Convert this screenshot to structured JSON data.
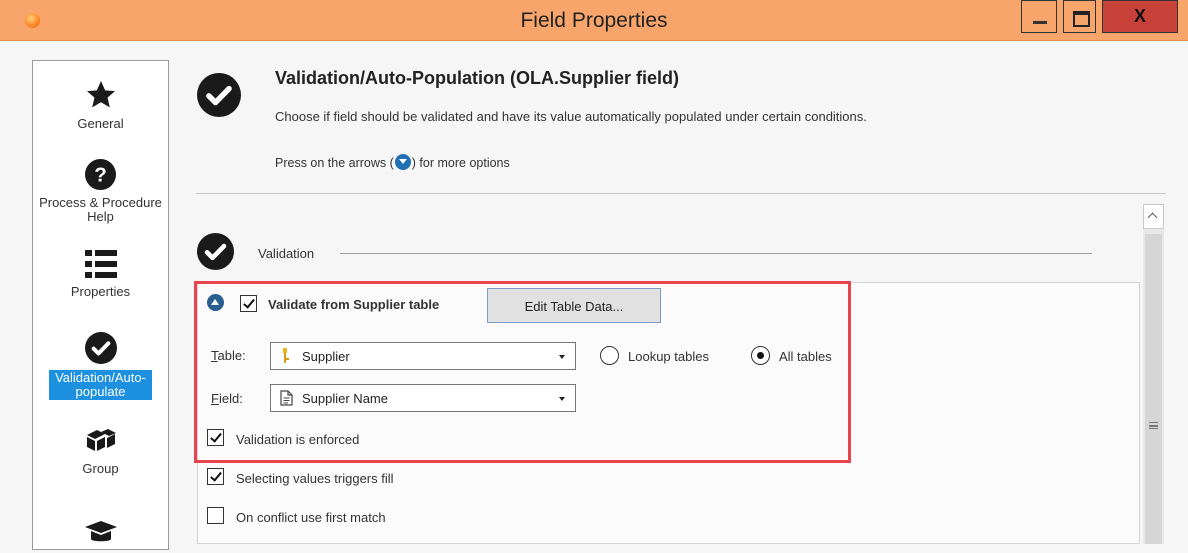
{
  "window": {
    "title": "Field Properties",
    "close_label": "X"
  },
  "sidebar": {
    "items": [
      {
        "label": "General",
        "icon": "star-icon"
      },
      {
        "label": "Process & Procedure Help",
        "icon": "question-icon"
      },
      {
        "label": "Properties",
        "icon": "list-icon"
      },
      {
        "label": "Validation/Auto-populate",
        "icon": "checkmark-icon",
        "selected": true
      },
      {
        "label": "Group",
        "icon": "group-icon"
      },
      {
        "label": "",
        "icon": "graduation-cap-icon"
      }
    ]
  },
  "header": {
    "title": "Validation/Auto-Population (OLA.Supplier field)",
    "description": "Choose if field should be validated and have its value automatically populated under certain conditions.",
    "hint_before": "Press on the arrows (",
    "hint_after": ") for more options"
  },
  "validation": {
    "section_label": "Validation",
    "validate_from_label": "Validate from Supplier table",
    "validate_from_checked": true,
    "edit_table_button": "Edit Table Data...",
    "table_label": "Table:",
    "table_value": "Supplier",
    "field_label": "Field:",
    "field_value": "Supplier Name",
    "lookup_tables_label": "Lookup tables",
    "all_tables_label": "All tables",
    "selected_scope": "All tables",
    "enforced_label": "Validation is enforced",
    "enforced_checked": true
  },
  "auto_population": {
    "triggers_fill_label": "Selecting values triggers fill",
    "triggers_fill_checked": true,
    "first_match_label": "On conflict use first match",
    "first_match_checked": false
  },
  "colors": {
    "title_bar": "#f7a56a",
    "selected_item": "#1e90e0",
    "highlight_border": "#e84450",
    "close_button": "#c9423a"
  }
}
